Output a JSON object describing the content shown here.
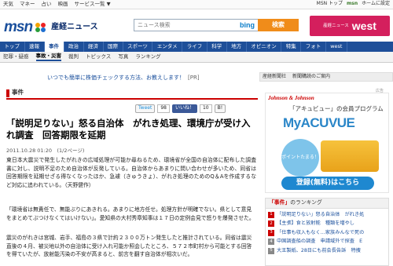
{
  "topbar": {
    "links": [
      "天気",
      "マネー",
      "占い",
      "映画",
      "サービス一覧 ▼"
    ],
    "right": [
      "MSN トップ",
      "msn",
      "ホーム",
      "に設定"
    ]
  },
  "header": {
    "logo_text": "msn",
    "site_name": "産経ニュース",
    "search_placeholder": "ニュース検索",
    "bing_label": "bing",
    "search_button": "検索",
    "west_pre": "産経ニュース",
    "west_big": "west"
  },
  "nav1": [
    "トップ",
    "速報",
    "事件",
    "政治",
    "経済",
    "国際",
    "スポーツ",
    "エンタメ",
    "ライフ",
    "科学",
    "地方",
    "オピニオン",
    "特集",
    "フォト",
    "west"
  ],
  "nav1_active": "事件",
  "nav2": [
    "犯罪・疑惑",
    "事故・災害",
    "裁判",
    "トピックス",
    "写真",
    "ランキング"
  ],
  "nav2_active": "事故・災害",
  "notice": {
    "text": "いつでも簡単に株価チェックする方法、お教えします！",
    "pr": "[PR]"
  },
  "right_banner": [
    "産経新聞社",
    "新聞購読のご案内"
  ],
  "section": {
    "label": "事件"
  },
  "social": {
    "tweet": "Tweet",
    "tweet_count": "98",
    "iine": "いいね！",
    "iine_count": "10",
    "b": "B!"
  },
  "article": {
    "headline": "「説明足りない」怒る自治体　がれき処理、環境庁が受け入れ調査　回答期限を延期",
    "date": "2011.10.28 01:20　(1/2ページ)",
    "p1": "東日本大震災で発生したがれきの広域処理が可能か尋ねるため、環境省が全国の自治体に配布した調査書に対し、説明不足のため自治体が反発している。自治体からあまりに問い合わせが多いため、同省は回答期限を延期せざる得なくなったほか、急遽（きゅうきょ）、がれき処理のためのQ＆Aを作成するなど対応に追われている。（天野健作）",
    "p2": "「環境省は無責任で、無能ぶりにあきれる。あまりに地方任せ。処理方針が明確でない。県として意見をまとめてぶつけなくてはいけない」。愛知県の大村秀章知事は１７日の定例会見で怒りを爆発させた。",
    "p3": "震災のがれきは宮城、岩手、福島の３県で計約２３００万トン発生したと推計されている。同省は震災直後の４月、被災地以外の自治体に受け入れ可能か照会したところ、５７２市町村から可能とする回答を得ていたが、放射能汚染の不安が高まると、前言を翻す自治体が相次いだ。"
  },
  "ad": {
    "label": "広告",
    "brand": "Johnson & Johnson",
    "line1": "「アキュビュー」の会員プログラム",
    "line2": "MyACUVUE",
    "circle": "ポイントたまる！",
    "register": "登録(無料)はこちら"
  },
  "ranking": {
    "title": "のランキング",
    "title_em": "「事件」",
    "items": [
      "「説明足りない」怒る自治体　がれき処",
      "【主張】食と放射能　種類を増やし",
      "「仕事も収入もなく…家族みんなで死の",
      "中国調査船の調査　申請域外で探査　E",
      "大王製紙、28日にも前会長告訴　特捜"
    ]
  }
}
